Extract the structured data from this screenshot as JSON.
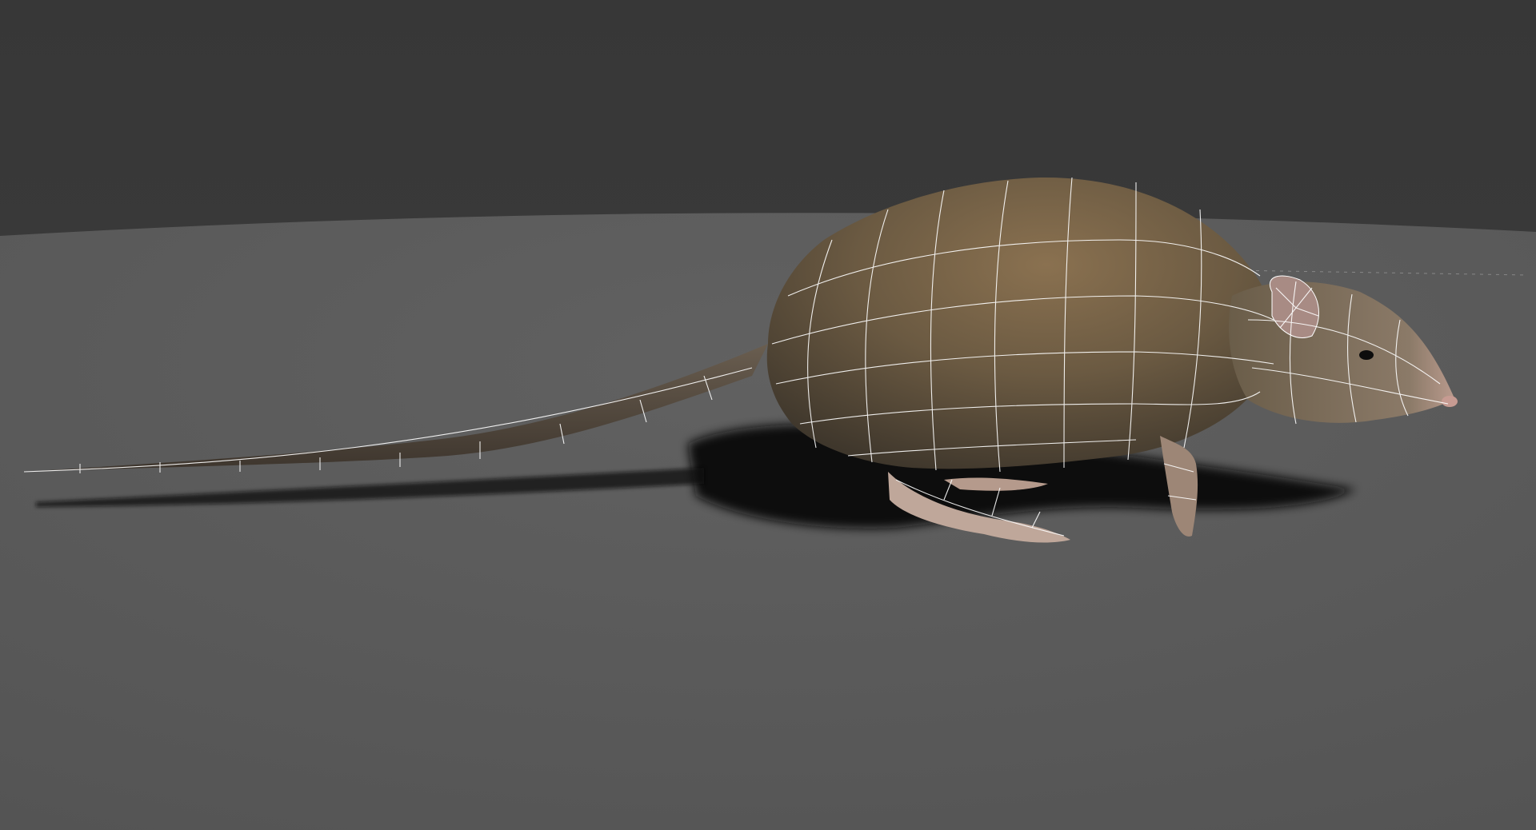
{
  "scene": {
    "subject_icon": "rat-model-icon",
    "render_mode": "textured-wireframe",
    "colors": {
      "background": "#3a3a3a",
      "ground": "#585858",
      "fur_dark": "#4a4030",
      "fur_light": "#8a7150",
      "tail": "#5d5245",
      "skin": "#c7a9a0",
      "wire": "#ffffff",
      "shadow": "#0b0b0b"
    }
  }
}
